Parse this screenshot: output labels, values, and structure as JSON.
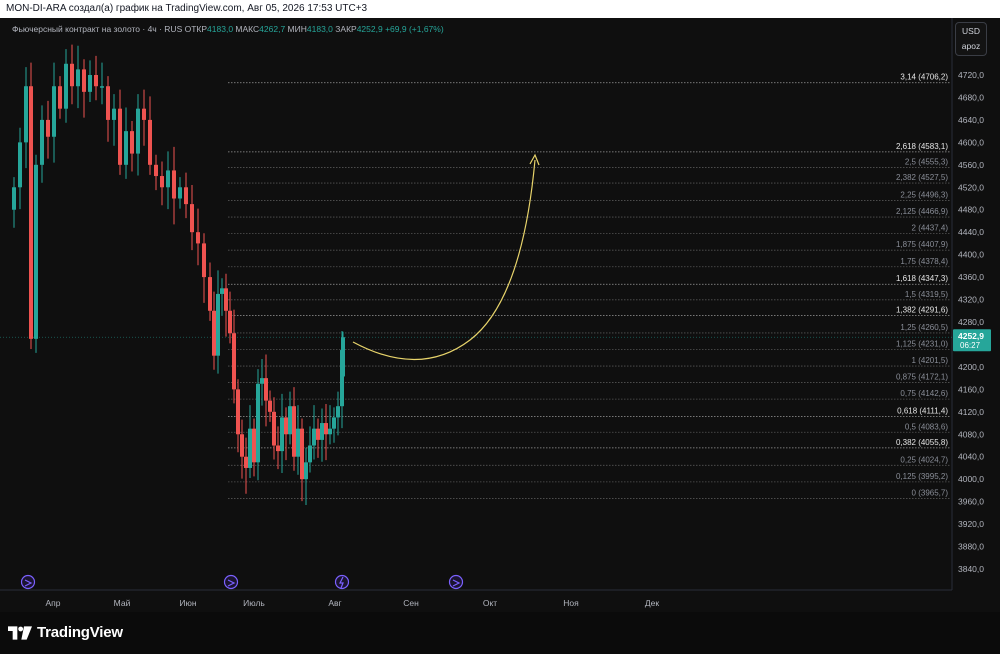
{
  "header": {
    "attribution": "MON-DI-ARA создал(а) график на TradingView.com, Авг 05, 2026 17:53 UTC+3"
  },
  "legend": {
    "symbol": "Фьючерсный контракт на золото · 4ч · RUS",
    "open_label": "ОТКР",
    "open_value": "4183,0",
    "high_label": "МАКС",
    "high_value": "4262,7",
    "low_label": "МИН",
    "low_value": "4183,0",
    "close_label": "ЗАКР",
    "close_value": "4252,9",
    "change": "+69,9 (+1,67%)"
  },
  "currency": {
    "code": "USD",
    "mode": "apoz"
  },
  "price_axis": {
    "ticks": [
      "4720,0",
      "4680,0",
      "4640,0",
      "4600,0",
      "4560,0",
      "4520,0",
      "4480,0",
      "4440,0",
      "4400,0",
      "4360,0",
      "4320,0",
      "4280,0",
      "4200,0",
      "4160,0",
      "4120,0",
      "4080,0",
      "4040,0",
      "4000,0",
      "3960,0",
      "3920,0",
      "3880,0",
      "3840,0"
    ],
    "current_price": "4252,9",
    "countdown": "06:27"
  },
  "time_axis": {
    "labels": [
      "Апр",
      "Май",
      "Июн",
      "Июль",
      "Авг",
      "Сен",
      "Окт",
      "Ноя",
      "Дек"
    ]
  },
  "fib_levels": [
    {
      "label": "3,14 (4706,2)",
      "key": true
    },
    {
      "label": "2,618 (4583,1)",
      "key": true
    },
    {
      "label": "2,5 (4555,3)",
      "key": false
    },
    {
      "label": "2,382 (4527,5)",
      "key": false
    },
    {
      "label": "2,25 (4496,3)",
      "key": false
    },
    {
      "label": "2,125 (4466,9)",
      "key": false
    },
    {
      "label": "2 (4437,4)",
      "key": false
    },
    {
      "label": "1,875 (4407,9)",
      "key": false
    },
    {
      "label": "1,75 (4378,4)",
      "key": false
    },
    {
      "label": "1,618 (4347,3)",
      "key": true
    },
    {
      "label": "1,5 (4319,5)",
      "key": false
    },
    {
      "label": "1,382 (4291,6)",
      "key": true
    },
    {
      "label": "1,25 (4260,5)",
      "key": false
    },
    {
      "label": "1,125 (4231,0)",
      "key": false
    },
    {
      "label": "1 (4201,5)",
      "key": false
    },
    {
      "label": "0,875 (4172,1)",
      "key": false
    },
    {
      "label": "0,75 (4142,6)",
      "key": false
    },
    {
      "label": "0,618 (4111,4)",
      "key": true
    },
    {
      "label": "0,5 (4083,6)",
      "key": false
    },
    {
      "label": "0,382 (4055,8)",
      "key": true
    },
    {
      "label": "0,25 (4024,7)",
      "key": false
    },
    {
      "label": "0,125 (3995,2)",
      "key": false
    },
    {
      "label": "0 (3965,7)",
      "key": false
    }
  ],
  "colors": {
    "up": "#26a69a",
    "down": "#ef5350",
    "projection": "#e8d46b",
    "event_icon": "#7b61ff",
    "price_tag": "#26a69a"
  },
  "event_icons": [
    "event-arrow-icon",
    "event-arrow-icon",
    "event-arrow-icon",
    "event-lightning-icon",
    "event-arrow-icon"
  ],
  "footer": {
    "brand": "TradingView"
  }
}
